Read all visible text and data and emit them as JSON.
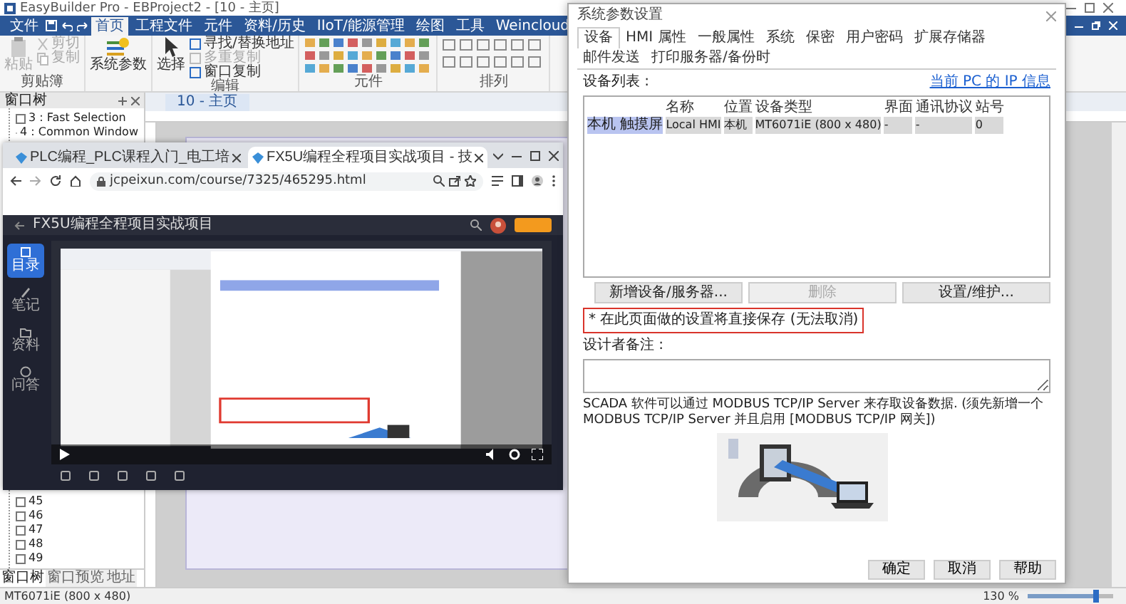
{
  "app": {
    "title": "EasyBuilder Pro - EBProject2 - [10 - 主页]",
    "menu": [
      {
        "label": "文件",
        "selected": false
      },
      {
        "label": "首页",
        "selected": true
      },
      {
        "label": "工程文件",
        "selected": false
      },
      {
        "label": "元件",
        "selected": false
      },
      {
        "label": "资料/历史",
        "selected": false
      },
      {
        "label": "IIoT/能源管理",
        "selected": false
      },
      {
        "label": "绘图",
        "selected": false
      },
      {
        "label": "工具",
        "selected": false
      },
      {
        "label": "Weincloud",
        "selected": false
      }
    ],
    "ribbon": {
      "clipboard": {
        "label": "剪贴簿",
        "paste": "粘贴",
        "cut": "剪切",
        "copy": "复制",
        "disabled": true
      },
      "system_parameters": "系统参数",
      "edit": {
        "label": "编辑",
        "select": "选择",
        "items": [
          {
            "label": "寻找/替换地址",
            "disabled": false
          },
          {
            "label": "多重复制",
            "disabled": true
          },
          {
            "label": "窗口复制",
            "disabled": false
          }
        ]
      },
      "elements": {
        "label": "元件"
      },
      "arrange": {
        "label": "排列"
      }
    },
    "window_tree": {
      "title": "窗口树",
      "items": [
        "3 : Fast Selection",
        "4 : Common Window"
      ],
      "bottom_items": [
        "45",
        "46",
        "47",
        "48",
        "49"
      ]
    },
    "panel_tabs": [
      {
        "label": "窗口树",
        "selected": true
      },
      {
        "label": "窗口预览",
        "selected": false
      },
      {
        "label": "地址",
        "selected": false
      }
    ],
    "document_tab": "10 - 主页",
    "status": "MT6071iE (800 x 480)",
    "zoom": {
      "text": "130 %",
      "level": 0.8
    }
  },
  "browser": {
    "tabs": [
      {
        "title": "PLC编程_PLC课程入门_电工培",
        "selected": false
      },
      {
        "title": "FX5U编程全程项目实战项目 - 技",
        "selected": true
      }
    ],
    "url": "jcpeixun.com/course/7325/465295.html",
    "page_title": "FX5U编程全程项目实战项目",
    "nav": [
      {
        "label": "目录",
        "selected": true
      },
      {
        "label": "笔记",
        "selected": false
      },
      {
        "label": "资料",
        "selected": false
      },
      {
        "label": "问答",
        "selected": false
      }
    ]
  },
  "dialog": {
    "title": "系统参数设置",
    "tabs": [
      {
        "label": "设备",
        "selected": true
      },
      {
        "label": "HMI 属性",
        "selected": false
      },
      {
        "label": "一般属性",
        "selected": false
      },
      {
        "label": "系统",
        "selected": false
      },
      {
        "label": "保密",
        "selected": false
      },
      {
        "label": "用户密码",
        "selected": false
      },
      {
        "label": "扩展存储器",
        "selected": false
      },
      {
        "label": "邮件发送",
        "selected": false
      },
      {
        "label": "打印服务器/备份时",
        "selected": false
      }
    ],
    "list_label": "设备列表 :",
    "ip_link": "当前 PC 的 IP 信息",
    "columns": [
      "",
      "名称",
      "位置",
      "设备类型",
      "界面",
      "通讯协议",
      "站号"
    ],
    "rows": [
      {
        "cells": [
          "本机 触摸屏",
          "Local HMI",
          "本机",
          "MT6071iE (800 x 480)",
          "-",
          "-",
          "0"
        ],
        "selected": true
      }
    ],
    "buttons": [
      {
        "label": "新增设备/服务器...",
        "disabled": false
      },
      {
        "label": "删除",
        "disabled": true
      },
      {
        "label": "设置/维护...",
        "disabled": false
      }
    ],
    "note": "* 在此页面做的设置将直接保存 (无法取消)",
    "remark_label": "设计者备注 :",
    "description": "SCADA 软件可以通过 MODBUS TCP/IP Server 来存取设备数据. (须先新增一个 MODBUS TCP/IP Server 并且启用 [MODBUS TCP/IP 网关])",
    "diagram": {
      "kind": "picture"
    },
    "footer_buttons": [
      "确定",
      "取消",
      "帮助"
    ]
  }
}
